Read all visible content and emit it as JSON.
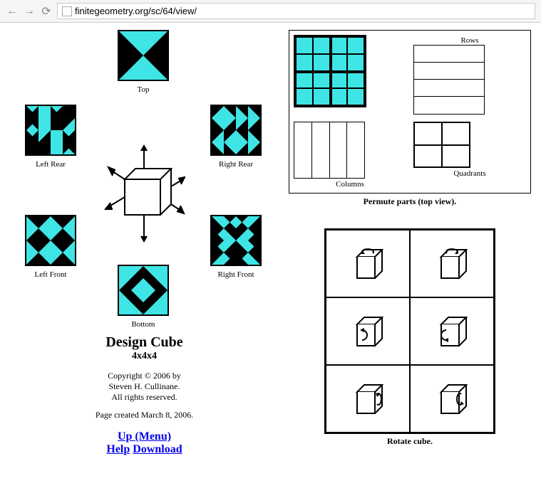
{
  "browser": {
    "url": "finitegeometry.org/sc/64/view/"
  },
  "faces": {
    "top": "Top",
    "leftRear": "Left Rear",
    "rightRear": "Right Rear",
    "leftFront": "Left Front",
    "rightFront": "Right Front",
    "bottom": "Bottom"
  },
  "title": {
    "main": "Design Cube",
    "sub": "4x4x4"
  },
  "copy": {
    "line1": "Copyright © 2006 by",
    "line2": "Steven H. Cullinane.",
    "line3": "All rights reserved.",
    "created": "Page created March 8, 2006."
  },
  "links": {
    "up": "Up (Menu)",
    "help": "Help",
    "download": "Download"
  },
  "permute": {
    "rows": "Rows",
    "columns": "Columns",
    "quadrants": "Quadrants",
    "caption": "Permute parts (top view)."
  },
  "rotate": {
    "caption": "Rotate cube."
  }
}
